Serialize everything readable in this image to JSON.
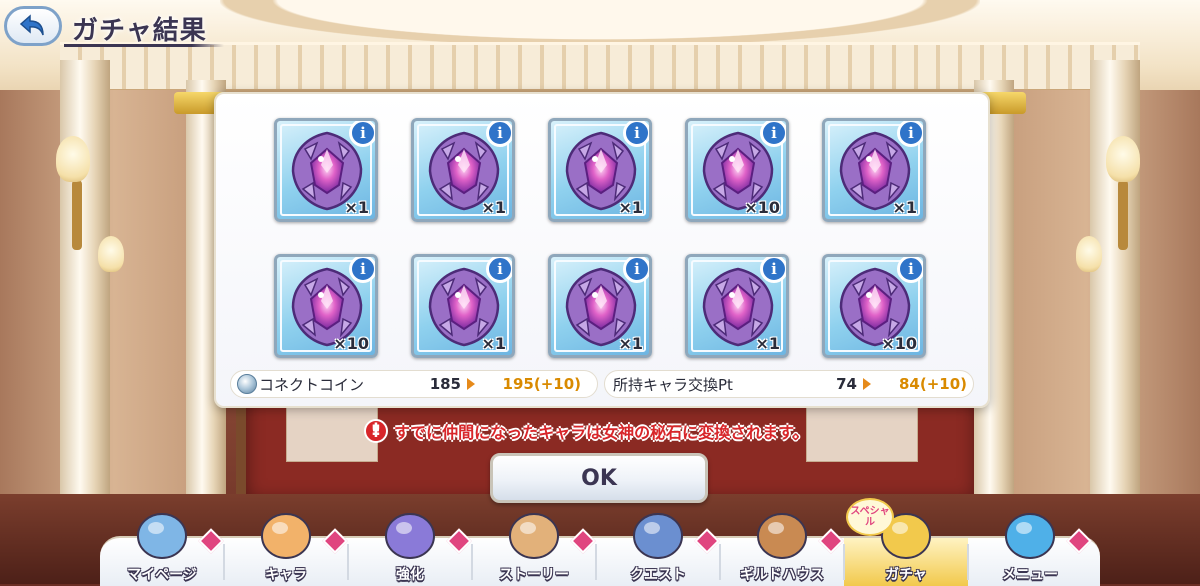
{
  "header": {
    "back_label": "",
    "title": "ガチャ結果"
  },
  "results": [
    {
      "qty": "×1"
    },
    {
      "qty": "×1"
    },
    {
      "qty": "×1"
    },
    {
      "qty": "×10"
    },
    {
      "qty": "×1"
    },
    {
      "qty": "×10"
    },
    {
      "qty": "×1"
    },
    {
      "qty": "×1"
    },
    {
      "qty": "×1"
    },
    {
      "qty": "×10"
    }
  ],
  "info_glyph": "i",
  "stats": {
    "coin": {
      "label": "コネクトコイン",
      "before": "185",
      "after": "195(+10)"
    },
    "exchange": {
      "label": "所持キャラ交換Pt",
      "before": "74",
      "after": "84(+10)"
    }
  },
  "notice": {
    "icon": "!",
    "text": "すでに仲間になったキャラは女神の秘石に変換されます。"
  },
  "ok_label": "OK",
  "nav": [
    {
      "label": "マイページ",
      "icon": "castle-icon",
      "active": false
    },
    {
      "label": "キャラ",
      "icon": "character-icon",
      "active": false
    },
    {
      "label": "強化",
      "icon": "orbs-icon",
      "active": false
    },
    {
      "label": "ストーリー",
      "icon": "scroll-icon",
      "active": false
    },
    {
      "label": "クエスト",
      "icon": "flag-sword-icon",
      "active": false
    },
    {
      "label": "ギルドハウス",
      "icon": "house-icon",
      "active": false
    },
    {
      "label": "ガチャ",
      "icon": "gacha-icon",
      "active": true
    },
    {
      "label": "メニュー",
      "icon": "crystal-icon",
      "active": false
    }
  ],
  "gacha_badge": "スペシャル",
  "colors": {
    "accent": "#2f74c9",
    "gain": "#d98a00",
    "warning": "#d8262a",
    "item_bg": "#8fd1ee",
    "gem": "#b16fe0"
  }
}
